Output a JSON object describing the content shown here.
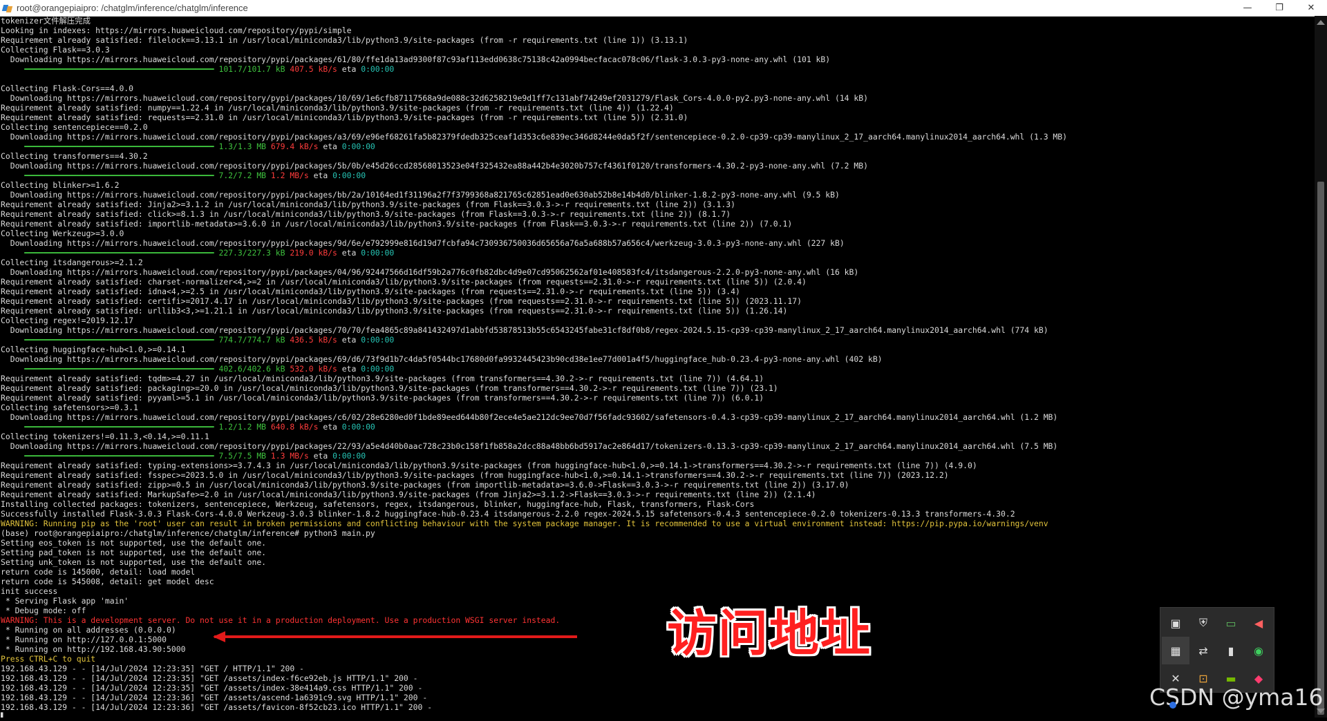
{
  "window": {
    "title": "root@orangepiaipro: /chatglm/inference/chatglm/inference",
    "minimize": "—",
    "maximize": "❐",
    "close": "✕"
  },
  "terminal": {
    "lines": [
      {
        "t": "white",
        "s": "tokenizer文件解压完成"
      },
      {
        "t": "white",
        "s": "Looking in indexes: https://mirrors.huaweicloud.com/repository/pypi/simple"
      },
      {
        "t": "white",
        "s": "Requirement already satisfied: filelock==3.13.1 in /usr/local/miniconda3/lib/python3.9/site-packages (from -r requirements.txt (line 1)) (3.13.1)"
      },
      {
        "t": "white",
        "s": "Collecting Flask==3.0.3"
      },
      {
        "t": "white",
        "s": "  Downloading https://mirrors.huaweicloud.com/repository/pypi/packages/61/80/ffe1da13ad9300f87c93af113edd0638c75138c42a0994becfacac078c06/flask-3.0.3-py3-none-any.whl (101 kB)"
      },
      {
        "t": "prog",
        "p": "101.7/101.7 kB",
        "sp": "407.5 kB/s",
        "eta": "0:00:00"
      },
      {
        "t": "white",
        "s": ""
      },
      {
        "t": "white",
        "s": "Collecting Flask-Cors==4.0.0"
      },
      {
        "t": "white",
        "s": "  Downloading https://mirrors.huaweicloud.com/repository/pypi/packages/10/69/1e6cfb87117568a9de088c32d6258219e9d1ff7c131abf74249ef2031279/Flask_Cors-4.0.0-py2.py3-none-any.whl (14 kB)"
      },
      {
        "t": "white",
        "s": "Requirement already satisfied: numpy==1.22.4 in /usr/local/miniconda3/lib/python3.9/site-packages (from -r requirements.txt (line 4)) (1.22.4)"
      },
      {
        "t": "white",
        "s": "Requirement already satisfied: requests==2.31.0 in /usr/local/miniconda3/lib/python3.9/site-packages (from -r requirements.txt (line 5)) (2.31.0)"
      },
      {
        "t": "white",
        "s": "Collecting sentencepiece==0.2.0"
      },
      {
        "t": "white",
        "s": "  Downloading https://mirrors.huaweicloud.com/repository/pypi/packages/a3/69/e96ef68261fa5b82379fdedb325ceaf1d353c6e839ec346d8244e0da5f2f/sentencepiece-0.2.0-cp39-cp39-manylinux_2_17_aarch64.manylinux2014_aarch64.whl (1.3 MB)"
      },
      {
        "t": "prog",
        "p": "1.3/1.3 MB",
        "sp": "679.4 kB/s",
        "eta": "0:00:00"
      },
      {
        "t": "white",
        "s": "Collecting transformers==4.30.2"
      },
      {
        "t": "white",
        "s": "  Downloading https://mirrors.huaweicloud.com/repository/pypi/packages/5b/0b/e45d26ccd28568013523e04f325432ea88a442b4e3020b757cf4361f0120/transformers-4.30.2-py3-none-any.whl (7.2 MB)"
      },
      {
        "t": "prog",
        "p": "7.2/7.2 MB",
        "sp": "1.2 MB/s",
        "eta": "0:00:00"
      },
      {
        "t": "white",
        "s": "Collecting blinker>=1.6.2"
      },
      {
        "t": "white",
        "s": "  Downloading https://mirrors.huaweicloud.com/repository/pypi/packages/bb/2a/10164ed1f31196a2f7f3799368a821765c62851ead0e630ab52b8e14b4d0/blinker-1.8.2-py3-none-any.whl (9.5 kB)"
      },
      {
        "t": "white",
        "s": "Requirement already satisfied: Jinja2>=3.1.2 in /usr/local/miniconda3/lib/python3.9/site-packages (from Flask==3.0.3->-r requirements.txt (line 2)) (3.1.3)"
      },
      {
        "t": "white",
        "s": "Requirement already satisfied: click>=8.1.3 in /usr/local/miniconda3/lib/python3.9/site-packages (from Flask==3.0.3->-r requirements.txt (line 2)) (8.1.7)"
      },
      {
        "t": "white",
        "s": "Requirement already satisfied: importlib-metadata>=3.6.0 in /usr/local/miniconda3/lib/python3.9/site-packages (from Flask==3.0.3->-r requirements.txt (line 2)) (7.0.1)"
      },
      {
        "t": "white",
        "s": "Collecting Werkzeug>=3.0.0"
      },
      {
        "t": "white",
        "s": "  Downloading https://mirrors.huaweicloud.com/repository/pypi/packages/9d/6e/e792999e816d19d7fcbfa94c730936750036d65656a76a5a688b57a656c4/werkzeug-3.0.3-py3-none-any.whl (227 kB)"
      },
      {
        "t": "prog",
        "p": "227.3/227.3 kB",
        "sp": "219.0 kB/s",
        "eta": "0:00:00"
      },
      {
        "t": "white",
        "s": "Collecting itsdangerous>=2.1.2"
      },
      {
        "t": "white",
        "s": "  Downloading https://mirrors.huaweicloud.com/repository/pypi/packages/04/96/92447566d16df59b2a776c0fb82dbc4d9e07cd95062562af01e408583fc4/itsdangerous-2.2.0-py3-none-any.whl (16 kB)"
      },
      {
        "t": "white",
        "s": "Requirement already satisfied: charset-normalizer<4,>=2 in /usr/local/miniconda3/lib/python3.9/site-packages (from requests==2.31.0->-r requirements.txt (line 5)) (2.0.4)"
      },
      {
        "t": "white",
        "s": "Requirement already satisfied: idna<4,>=2.5 in /usr/local/miniconda3/lib/python3.9/site-packages (from requests==2.31.0->-r requirements.txt (line 5)) (3.4)"
      },
      {
        "t": "white",
        "s": "Requirement already satisfied: certifi>=2017.4.17 in /usr/local/miniconda3/lib/python3.9/site-packages (from requests==2.31.0->-r requirements.txt (line 5)) (2023.11.17)"
      },
      {
        "t": "white",
        "s": "Requirement already satisfied: urllib3<3,>=1.21.1 in /usr/local/miniconda3/lib/python3.9/site-packages (from requests==2.31.0->-r requirements.txt (line 5)) (1.26.14)"
      },
      {
        "t": "white",
        "s": "Collecting regex!=2019.12.17"
      },
      {
        "t": "white",
        "s": "  Downloading https://mirrors.huaweicloud.com/repository/pypi/packages/70/70/fea4865c89a841432497d1abbfd53878513b55c6543245fabe31cf8df0b8/regex-2024.5.15-cp39-cp39-manylinux_2_17_aarch64.manylinux2014_aarch64.whl (774 kB)"
      },
      {
        "t": "prog",
        "p": "774.7/774.7 kB",
        "sp": "436.5 kB/s",
        "eta": "0:00:00"
      },
      {
        "t": "white",
        "s": "Collecting huggingface-hub<1.0,>=0.14.1"
      },
      {
        "t": "white",
        "s": "  Downloading https://mirrors.huaweicloud.com/repository/pypi/packages/69/d6/73f9d1b7c4da5f0544bc17680d0fa9932445423b90cd38e1ee77d001a4f5/huggingface_hub-0.23.4-py3-none-any.whl (402 kB)"
      },
      {
        "t": "prog",
        "p": "402.6/402.6 kB",
        "sp": "532.0 kB/s",
        "eta": "0:00:00"
      },
      {
        "t": "white",
        "s": "Requirement already satisfied: tqdm>=4.27 in /usr/local/miniconda3/lib/python3.9/site-packages (from transformers==4.30.2->-r requirements.txt (line 7)) (4.64.1)"
      },
      {
        "t": "white",
        "s": "Requirement already satisfied: packaging>=20.0 in /usr/local/miniconda3/lib/python3.9/site-packages (from transformers==4.30.2->-r requirements.txt (line 7)) (23.1)"
      },
      {
        "t": "white",
        "s": "Requirement already satisfied: pyyaml>=5.1 in /usr/local/miniconda3/lib/python3.9/site-packages (from transformers==4.30.2->-r requirements.txt (line 7)) (6.0.1)"
      },
      {
        "t": "white",
        "s": "Collecting safetensors>=0.3.1"
      },
      {
        "t": "white",
        "s": "  Downloading https://mirrors.huaweicloud.com/repository/pypi/packages/c6/02/28e6280ed0f1bde89eed644b80f2ece4e5ae212dc9ee70d7f56fadc93602/safetensors-0.4.3-cp39-cp39-manylinux_2_17_aarch64.manylinux2014_aarch64.whl (1.2 MB)"
      },
      {
        "t": "prog",
        "p": "1.2/1.2 MB",
        "sp": "640.8 kB/s",
        "eta": "0:00:00"
      },
      {
        "t": "white",
        "s": "Collecting tokenizers!=0.11.3,<0.14,>=0.11.1"
      },
      {
        "t": "white",
        "s": "  Downloading https://mirrors.huaweicloud.com/repository/pypi/packages/22/93/a5e4d40b0aac728c23b0c158f1fb858a2dcc88a48bb6bd5917ac2e864d17/tokenizers-0.13.3-cp39-cp39-manylinux_2_17_aarch64.manylinux2014_aarch64.whl (7.5 MB)"
      },
      {
        "t": "prog",
        "p": "7.5/7.5 MB",
        "sp": "1.3 MB/s",
        "eta": "0:00:00"
      },
      {
        "t": "white",
        "s": "Requirement already satisfied: typing-extensions>=3.7.4.3 in /usr/local/miniconda3/lib/python3.9/site-packages (from huggingface-hub<1.0,>=0.14.1->transformers==4.30.2->-r requirements.txt (line 7)) (4.9.0)"
      },
      {
        "t": "white",
        "s": "Requirement already satisfied: fsspec>=2023.5.0 in /usr/local/miniconda3/lib/python3.9/site-packages (from huggingface-hub<1.0,>=0.14.1->transformers==4.30.2->-r requirements.txt (line 7)) (2023.12.2)"
      },
      {
        "t": "white",
        "s": "Requirement already satisfied: zipp>=0.5 in /usr/local/miniconda3/lib/python3.9/site-packages (from importlib-metadata>=3.6.0->Flask==3.0.3->-r requirements.txt (line 2)) (3.17.0)"
      },
      {
        "t": "white",
        "s": "Requirement already satisfied: MarkupSafe>=2.0 in /usr/local/miniconda3/lib/python3.9/site-packages (from Jinja2>=3.1.2->Flask==3.0.3->-r requirements.txt (line 2)) (2.1.4)"
      },
      {
        "t": "white",
        "s": "Installing collected packages: tokenizers, sentencepiece, Werkzeug, safetensors, regex, itsdangerous, blinker, huggingface-hub, Flask, transformers, Flask-Cors"
      },
      {
        "t": "white",
        "s": "Successfully installed Flask-3.0.3 Flask-Cors-4.0.0 Werkzeug-3.0.3 blinker-1.8.2 huggingface-hub-0.23.4 itsdangerous-2.2.0 regex-2024.5.15 safetensors-0.4.3 sentencepiece-0.2.0 tokenizers-0.13.3 transformers-4.30.2"
      },
      {
        "t": "yellow",
        "s": "WARNING: Running pip as the 'root' user can result in broken permissions and conflicting behaviour with the system package manager. It is recommended to use a virtual environment instead: https://pip.pypa.io/warnings/venv"
      },
      {
        "t": "white",
        "s": "(base) root@orangepiaipro:/chatglm/inference/chatglm/inference# python3 main.py"
      },
      {
        "t": "white",
        "s": "Setting eos_token is not supported, use the default one."
      },
      {
        "t": "white",
        "s": "Setting pad_token is not supported, use the default one."
      },
      {
        "t": "white",
        "s": "Setting unk_token is not supported, use the default one."
      },
      {
        "t": "white",
        "s": "return code is 145000, detail: load model"
      },
      {
        "t": "white",
        "s": "return code is 545008, detail: get model desc"
      },
      {
        "t": "white",
        "s": "init success"
      },
      {
        "t": "white",
        "s": " * Serving Flask app 'main'"
      },
      {
        "t": "white",
        "s": " * Debug mode: off"
      },
      {
        "t": "red",
        "s": "WARNING: This is a development server. Do not use it in a production deployment. Use a production WSGI server instead."
      },
      {
        "t": "white",
        "s": " * Running on all addresses (0.0.0.0)"
      },
      {
        "t": "white",
        "s": " * Running on http://127.0.0.1:5000"
      },
      {
        "t": "white",
        "s": " * Running on http://192.168.43.90:5000"
      },
      {
        "t": "yellow",
        "s": "Press CTRL+C to quit"
      },
      {
        "t": "white",
        "s": "192.168.43.129 - - [14/Jul/2024 12:23:35] \"GET / HTTP/1.1\" 200 -"
      },
      {
        "t": "white",
        "s": "192.168.43.129 - - [14/Jul/2024 12:23:35] \"GET /assets/index-f6ce92eb.js HTTP/1.1\" 200 -"
      },
      {
        "t": "white",
        "s": "192.168.43.129 - - [14/Jul/2024 12:23:35] \"GET /assets/index-38e414a9.css HTTP/1.1\" 200 -"
      },
      {
        "t": "white",
        "s": "192.168.43.129 - - [14/Jul/2024 12:23:36] \"GET /assets/ascend-1a6391c9.svg HTTP/1.1\" 200 -"
      },
      {
        "t": "white",
        "s": "192.168.43.129 - - [14/Jul/2024 12:23:36] \"GET /assets/favicon-8f52cb23.ico HTTP/1.1\" 200 -"
      },
      {
        "t": "white",
        "s": "▌"
      }
    ],
    "progress_bar": "━━━━━━━━━━━━━━━━━━━━━━━━━━━━━━━━━━━━━━━━",
    "eta_label": "eta"
  },
  "annotation": {
    "text": "访问地址",
    "color": "#ff2020"
  },
  "tray": {
    "icons": [
      "screen-capture-icon",
      "security-shield-icon",
      "network-card-icon",
      "audio-alert-icon",
      "windows-security-icon",
      "bluetooth-transfer-icon",
      "battery-icon",
      "wechat-icon",
      "volume-mute-icon",
      "camera-icon",
      "nvidia-icon",
      "app-notify-icon"
    ],
    "glyphs": [
      "▣",
      "⛨",
      "▭",
      "◀",
      "▦",
      "⇄",
      "▮",
      "◉",
      "✕",
      "⊡",
      "▬",
      "◆"
    ],
    "colors": [
      "#dddddd",
      "#dddddd",
      "#5fb85f",
      "#ff6060",
      "#e8e8e8",
      "#dddddd",
      "#dddddd",
      "#3fcf5f",
      "#dddddd",
      "#e8a23a",
      "#76b900",
      "#ff3c6f"
    ]
  },
  "watermark": "CSDN @yma16"
}
